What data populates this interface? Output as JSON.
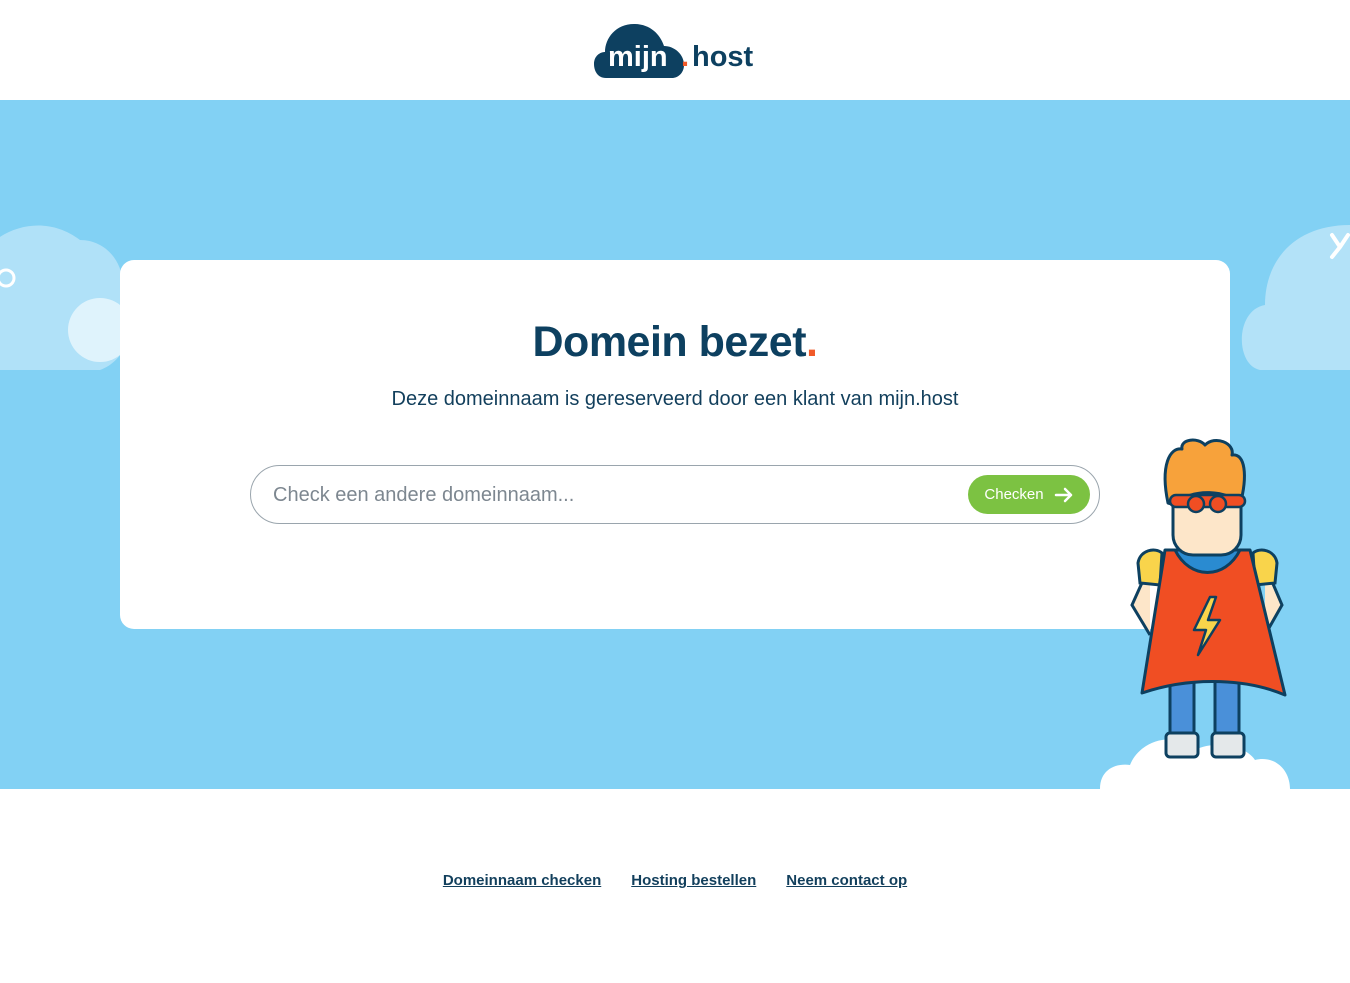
{
  "brand": {
    "logo_left": "mijn",
    "logo_dot": ".",
    "logo_right": "host"
  },
  "card": {
    "title": "Domein bezet",
    "title_dot": ".",
    "subtitle": "Deze domeinnaam is gereserveerd door een klant van mijn.host",
    "search_placeholder": "Check een andere domeinnaam...",
    "button_label": "Checken",
    "button_icon": "arrow-right-icon"
  },
  "footer": {
    "links": [
      "Domeinnaam checken",
      "Hosting bestellen",
      "Neem contact op"
    ]
  },
  "colors": {
    "navy": "#0d4060",
    "accent_orange": "#f15a29",
    "sky": "#82d1f4",
    "green": "#7cc242"
  }
}
